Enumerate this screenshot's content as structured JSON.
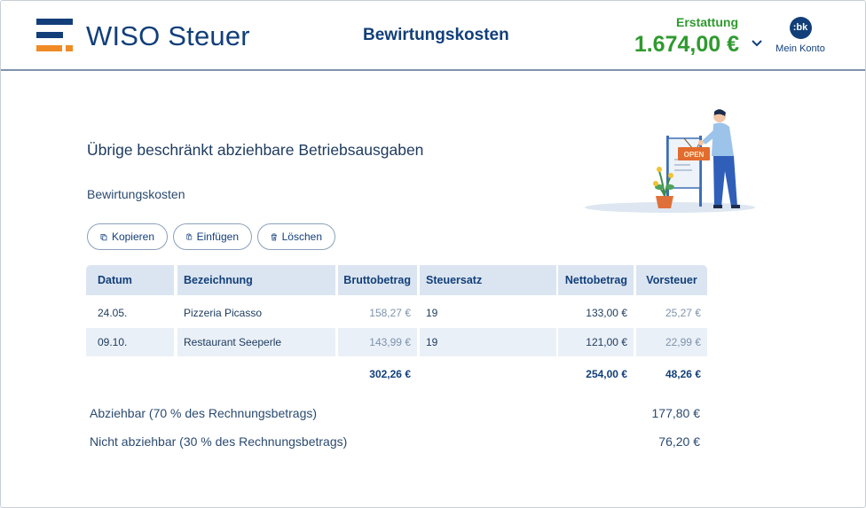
{
  "app": {
    "logo_text": "WISO Steuer",
    "page_title": "Bewirtungskosten",
    "refund_label": "Erstattung",
    "refund_value": "1.674,00 €",
    "account_initials": ":bk",
    "account_label": "Mein Konto",
    "colors": {
      "brand_blue": "#123f7a",
      "brand_orange": "#f08a24",
      "refund_green": "#2f9a2f",
      "table_header": "#dbe5f1",
      "row_shade": "#eaf0f7"
    }
  },
  "main": {
    "section_title": "Übrige beschränkt abziehbare Betriebsausgaben",
    "sub_title": "Bewirtungskosten",
    "illustration_sign_text": "OPEN",
    "toolbar": {
      "copy_label": "Kopieren",
      "paste_label": "Einfügen",
      "delete_label": "Löschen",
      "copy_icon": "copy-icon",
      "paste_icon": "paste-icon",
      "delete_icon": "trash-icon"
    },
    "table": {
      "headers": {
        "datum": "Datum",
        "bezeichnung": "Bezeichnung",
        "brutto": "Bruttobetrag",
        "steuersatz": "Steuersatz",
        "netto": "Nettobetrag",
        "vorsteuer": "Vorsteuer"
      },
      "rows": [
        {
          "datum": "24.05.",
          "bezeichnung": "Pizzeria Picasso",
          "brutto": "158,27 €",
          "steuersatz": "19",
          "netto": "133,00 €",
          "vorsteuer": "25,27 €"
        },
        {
          "datum": "09.10.",
          "bezeichnung": "Restaurant Seeperle",
          "brutto": "143,99 €",
          "steuersatz": "19",
          "netto": "121,00 €",
          "vorsteuer": "22,99 €"
        }
      ],
      "totals": {
        "brutto": "302,26 €",
        "netto": "254,00 €",
        "vorsteuer": "48,26 €"
      }
    },
    "summary": [
      {
        "label": "Abziehbar (70 % des Rechnungsbetrags)",
        "value": "177,80 €"
      },
      {
        "label": "Nicht abziehbar (30 % des Rechnungsbetrags)",
        "value": "76,20 €"
      }
    ]
  }
}
